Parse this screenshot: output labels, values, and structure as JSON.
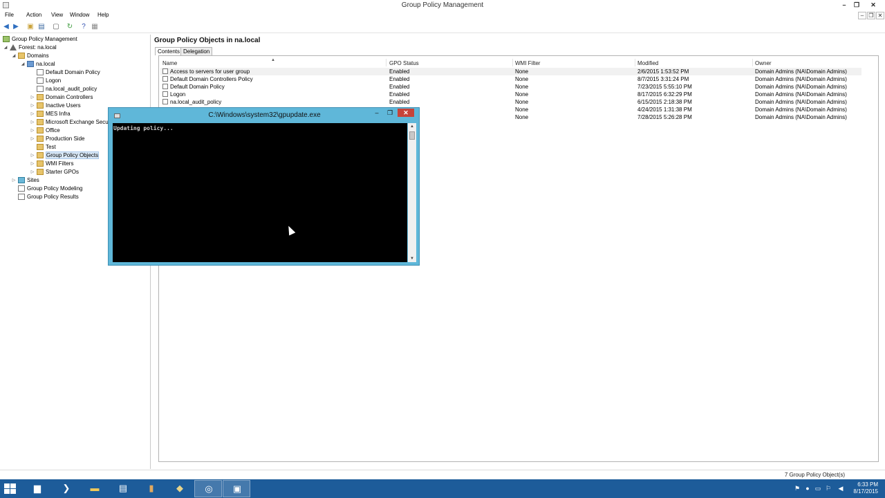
{
  "window": {
    "title": "Group Policy Management",
    "controls": {
      "minimize": "–",
      "restore": "❐",
      "close": "✕"
    }
  },
  "menu": [
    "File",
    "Action",
    "View",
    "Window",
    "Help"
  ],
  "mdi_controls": [
    "–",
    "❐",
    "✕"
  ],
  "tree": {
    "root": "Group Policy Management",
    "forest": "Forest: na.local",
    "domains": "Domains",
    "domain": "na.local",
    "children": [
      "Default Domain Policy",
      "Logon",
      "na.local_audit_policy",
      "Domain Controllers",
      "Inactive Users",
      "MES Infra",
      "Microsoft Exchange Security Groups",
      "Office",
      "Production Side",
      "Test",
      "Group Policy Objects",
      "WMI Filters",
      "Starter GPOs"
    ],
    "sites": "Sites",
    "modeling": "Group Policy Modeling",
    "results": "Group Policy Results"
  },
  "right_pane": {
    "title": "Group Policy Objects in na.local",
    "tabs": [
      "Contents",
      "Delegation"
    ],
    "columns": [
      "Name",
      "GPO Status",
      "WMI Filter",
      "Modified",
      "Owner"
    ],
    "rows": [
      {
        "name": "Access to servers for user group",
        "status": "Enabled",
        "wmi": "None",
        "modified": "2/6/2015 1:53:52 PM",
        "owner": "Domain Admins (NA\\Domain Admins)"
      },
      {
        "name": "Default Domain Controllers Policy",
        "status": "Enabled",
        "wmi": "None",
        "modified": "8/7/2015 3:31:24 PM",
        "owner": "Domain Admins (NA\\Domain Admins)"
      },
      {
        "name": "Default Domain Policy",
        "status": "Enabled",
        "wmi": "None",
        "modified": "7/23/2015 5:55:10 PM",
        "owner": "Domain Admins (NA\\Domain Admins)"
      },
      {
        "name": "Logon",
        "status": "Enabled",
        "wmi": "None",
        "modified": "8/17/2015 6:32:29 PM",
        "owner": "Domain Admins (NA\\Domain Admins)"
      },
      {
        "name": "na.local_audit_policy",
        "status": "Enabled",
        "wmi": "None",
        "modified": "6/15/2015 2:18:38 PM",
        "owner": "Domain Admins (NA\\Domain Admins)"
      },
      {
        "name": "",
        "status": "",
        "wmi": "None",
        "modified": "4/24/2015 1:31:38 PM",
        "owner": "Domain Admins (NA\\Domain Admins)"
      },
      {
        "name": "",
        "status": "",
        "wmi": "None",
        "modified": "7/28/2015 5:26:28 PM",
        "owner": "Domain Admins (NA\\Domain Admins)"
      }
    ]
  },
  "status_bar": "7 Group Policy Object(s)",
  "console": {
    "title": "C:\\Windows\\system32\\gpupdate.exe",
    "output": "Updating policy...",
    "controls": {
      "minimize": "–",
      "maximize": "❐",
      "close": "✕"
    }
  },
  "taskbar": {
    "clock_time": "6:33 PM",
    "clock_date": "8/17/2015"
  },
  "colors": {
    "taskbar": "#1d5c9a",
    "console_frame": "#5fb7d9",
    "console_close": "#c7443a"
  }
}
